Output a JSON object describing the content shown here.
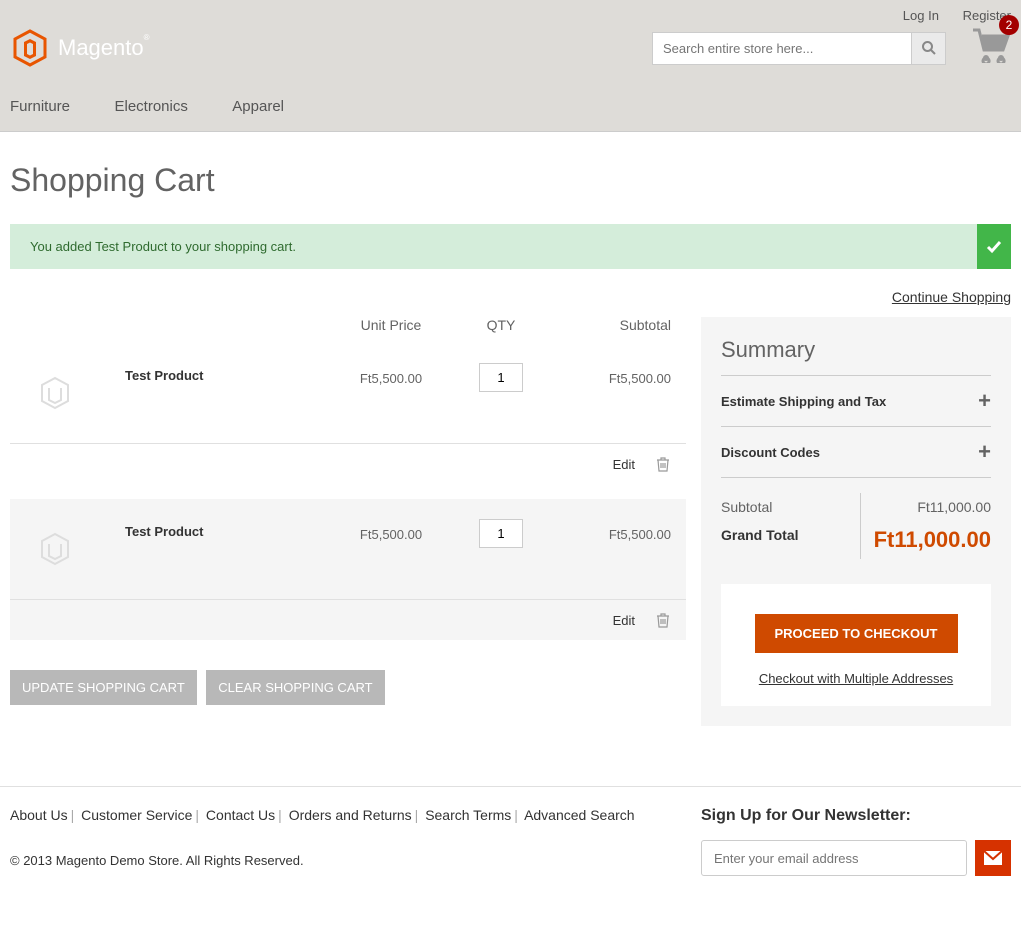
{
  "header": {
    "login": "Log In",
    "register": "Register",
    "search_placeholder": "Search entire store here...",
    "cart_count": "2",
    "logo_text": "Magento"
  },
  "nav": {
    "items": [
      "Furniture",
      "Electronics",
      "Apparel"
    ]
  },
  "page": {
    "title": "Shopping Cart",
    "success_msg": "You added Test Product to your shopping cart.",
    "continue": "Continue Shopping"
  },
  "cart": {
    "headers": {
      "price": "Unit Price",
      "qty": "QTY",
      "subtotal": "Subtotal"
    },
    "items": [
      {
        "name": "Test Product",
        "price": "Ft5,500.00",
        "qty": "1",
        "subtotal": "Ft5,500.00",
        "edit": "Edit"
      },
      {
        "name": "Test Product",
        "price": "Ft5,500.00",
        "qty": "1",
        "subtotal": "Ft5,500.00",
        "edit": "Edit"
      }
    ],
    "update_btn": "UPDATE SHOPPING CART",
    "clear_btn": "CLEAR SHOPPING CART"
  },
  "summary": {
    "title": "Summary",
    "estimate": "Estimate Shipping and Tax",
    "discount": "Discount Codes",
    "subtotal_label": "Subtotal",
    "subtotal_value": "Ft11,000.00",
    "grand_label": "Grand Total",
    "grand_value": "Ft11,000.00",
    "checkout_btn": "PROCEED TO CHECKOUT",
    "multi_addr": "Checkout with Multiple Addresses"
  },
  "footer": {
    "links": [
      "About Us",
      "Customer Service",
      "Contact Us",
      "Orders and Returns",
      "Search Terms",
      "Advanced Search"
    ],
    "copyright": "© 2013 Magento Demo Store. All Rights Reserved.",
    "newsletter_title": "Sign Up for Our Newsletter:",
    "newsletter_placeholder": "Enter your email address"
  }
}
